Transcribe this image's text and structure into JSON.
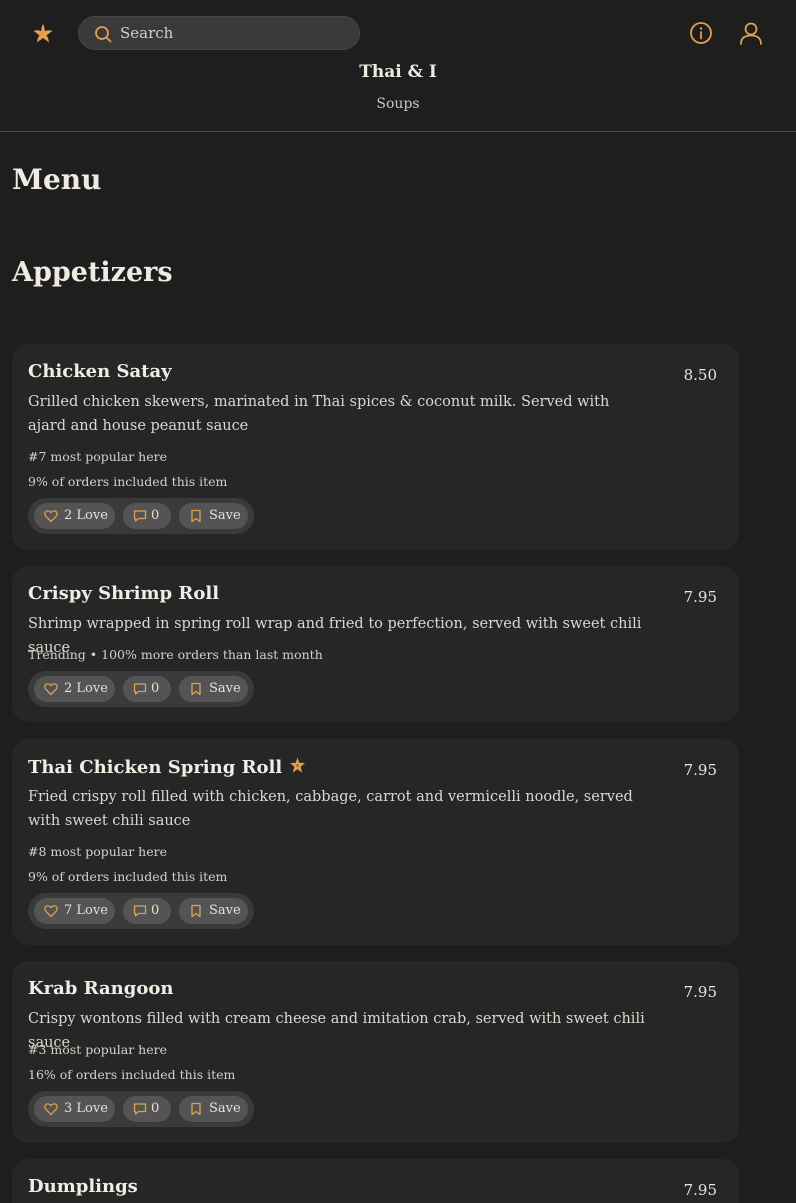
{
  "header": {
    "search_placeholder": "Search",
    "restaurant_name": "Thai & I",
    "current_category": "Soups"
  },
  "page": {
    "title": "Menu",
    "section_title": "Appetizers"
  },
  "colors": {
    "accent": "#e0a050",
    "background": "#1e1e1e",
    "card": "#262626"
  },
  "items": [
    {
      "name": "Chicken Satay",
      "price": "8.50",
      "description": "Grilled chicken skewers, marinated in Thai spices & coconut milk. Served with ajard and house peanut sauce",
      "stat1": "#7 most popular here",
      "stat2": "9% of orders included this item",
      "love": "2 Love",
      "comments": "0",
      "save": "Save"
    },
    {
      "name": "Crispy Shrimp Roll",
      "price": "7.95",
      "description": "Shrimp wrapped in spring roll wrap and fried to perfection, served with sweet chili sauce",
      "stat1": "Trending • 100% more orders than last month",
      "love": "2 Love",
      "comments": "0",
      "save": "Save"
    },
    {
      "name": "Thai Chicken Spring Roll",
      "price": "7.95",
      "description": "Fried crispy roll filled with chicken, cabbage, carrot and vermicelli noodle, served with sweet chili sauce",
      "stat1": "#8 most popular here",
      "stat2": "9% of orders included this item",
      "love": "7 Love",
      "comments": "0",
      "save": "Save"
    },
    {
      "name": "Krab Rangoon",
      "price": "7.95",
      "description": "Crispy wontons filled with cream cheese and imitation crab, served with sweet chili sauce",
      "stat1": "#3 most popular here",
      "stat2": "16% of orders included this item",
      "love": "3 Love",
      "comments": "0",
      "save": "Save"
    },
    {
      "name": "Dumplings",
      "price": "7.95"
    }
  ]
}
